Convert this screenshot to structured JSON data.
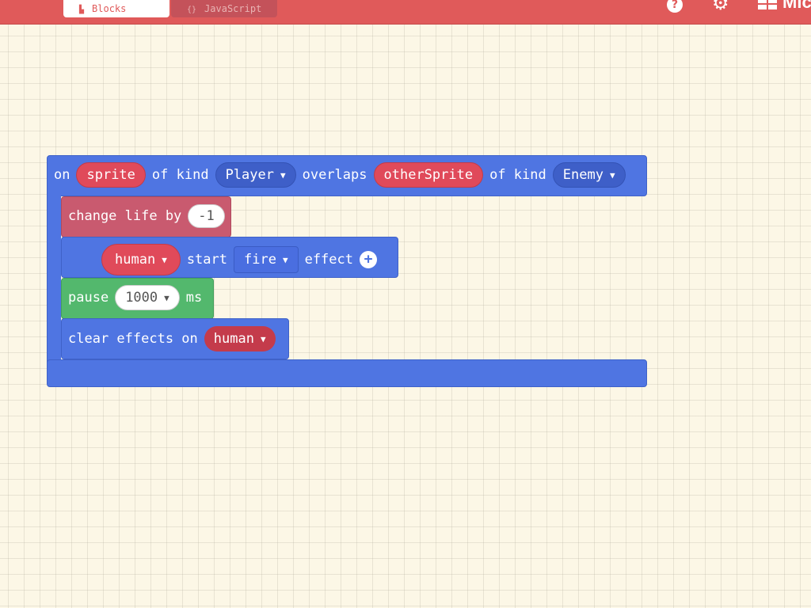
{
  "header": {
    "tabs": [
      {
        "label": "Blocks",
        "icon": "blocks-icon"
      },
      {
        "label": "JavaScript",
        "icon": "braces-icon"
      }
    ],
    "help_icon": "?",
    "settings_icon": "⚙",
    "brand_text": "Mic"
  },
  "colors": {
    "header": "#e05a5a",
    "sprites_block": "#4f75e2",
    "info_block": "#c95a6f",
    "loops_block": "#53b86d",
    "canvas": "#fcf7e6"
  },
  "event_block": {
    "on": "on",
    "sprite_var": "sprite",
    "of_kind_1": "of kind",
    "kind_1": "Player",
    "overlaps": "overlaps",
    "other_var": "otherSprite",
    "of_kind_2": "of kind",
    "kind_2": "Enemy"
  },
  "change_life": {
    "label": "change life by",
    "value": "-1"
  },
  "start_effect": {
    "sprite": "human",
    "start": "start",
    "effect_name": "fire",
    "effect": "effect"
  },
  "pause": {
    "label": "pause",
    "value": "1000",
    "unit": "ms"
  },
  "clear_effects": {
    "label": "clear effects on",
    "sprite": "human"
  }
}
